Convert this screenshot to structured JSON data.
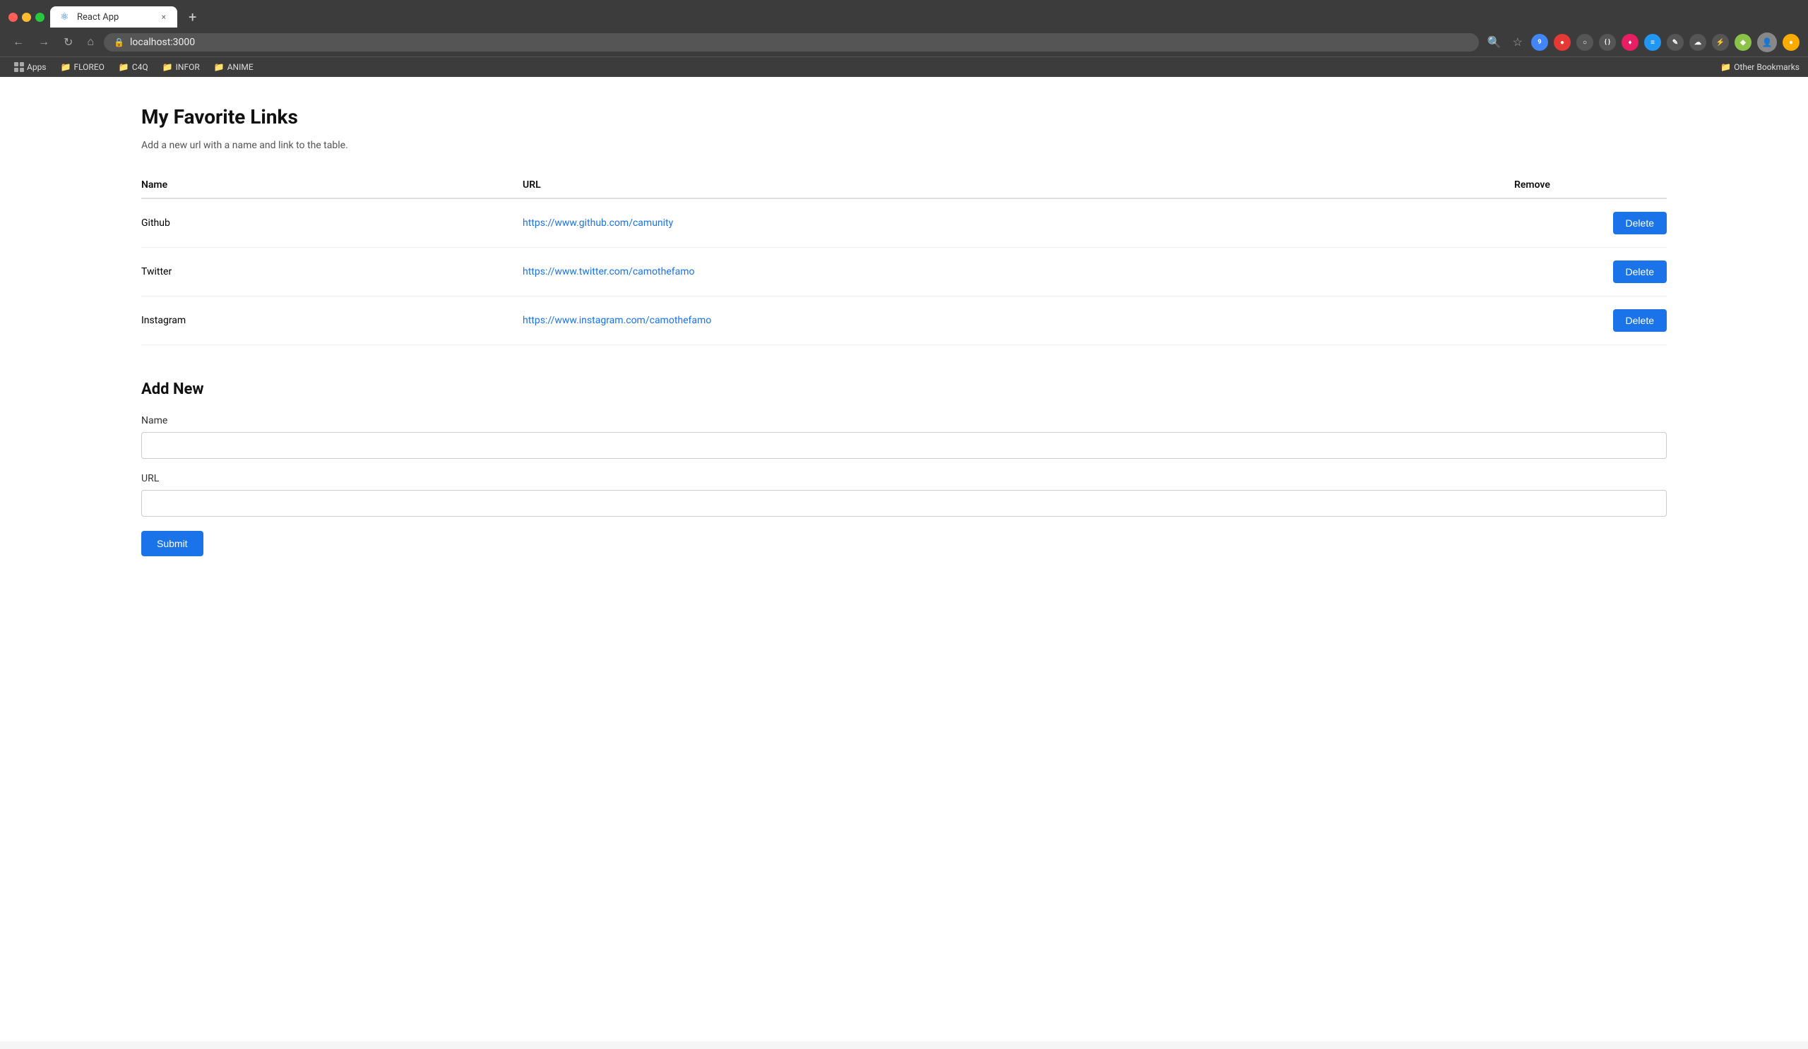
{
  "browser": {
    "tab_title": "React App",
    "tab_close": "×",
    "tab_add": "+",
    "address": "localhost:3000",
    "back_label": "←",
    "forward_label": "→",
    "reload_label": "↻",
    "home_label": "⌂"
  },
  "bookmarks": {
    "items": [
      {
        "icon": "📁",
        "label": "FLOREO"
      },
      {
        "icon": "📁",
        "label": "C4Q"
      },
      {
        "icon": "📁",
        "label": "INFOR"
      },
      {
        "icon": "📁",
        "label": "ANIME"
      }
    ],
    "apps_label": "Apps",
    "other_label": "Other Bookmarks"
  },
  "page": {
    "title": "My Favorite Links",
    "subtitle": "Add a new url with a name and link to the table.",
    "table": {
      "col_name": "Name",
      "col_url": "URL",
      "col_remove": "Remove",
      "rows": [
        {
          "name": "Github",
          "url": "https://www.github.com/camunity"
        },
        {
          "name": "Twitter",
          "url": "https://www.twitter.com/camothefamo"
        },
        {
          "name": "Instagram",
          "url": "https://www.instagram.com/camothefamo"
        }
      ],
      "delete_label": "Delete"
    },
    "form": {
      "title": "Add New",
      "name_label": "Name",
      "name_placeholder": "",
      "url_label": "URL",
      "url_placeholder": "",
      "submit_label": "Submit"
    }
  }
}
